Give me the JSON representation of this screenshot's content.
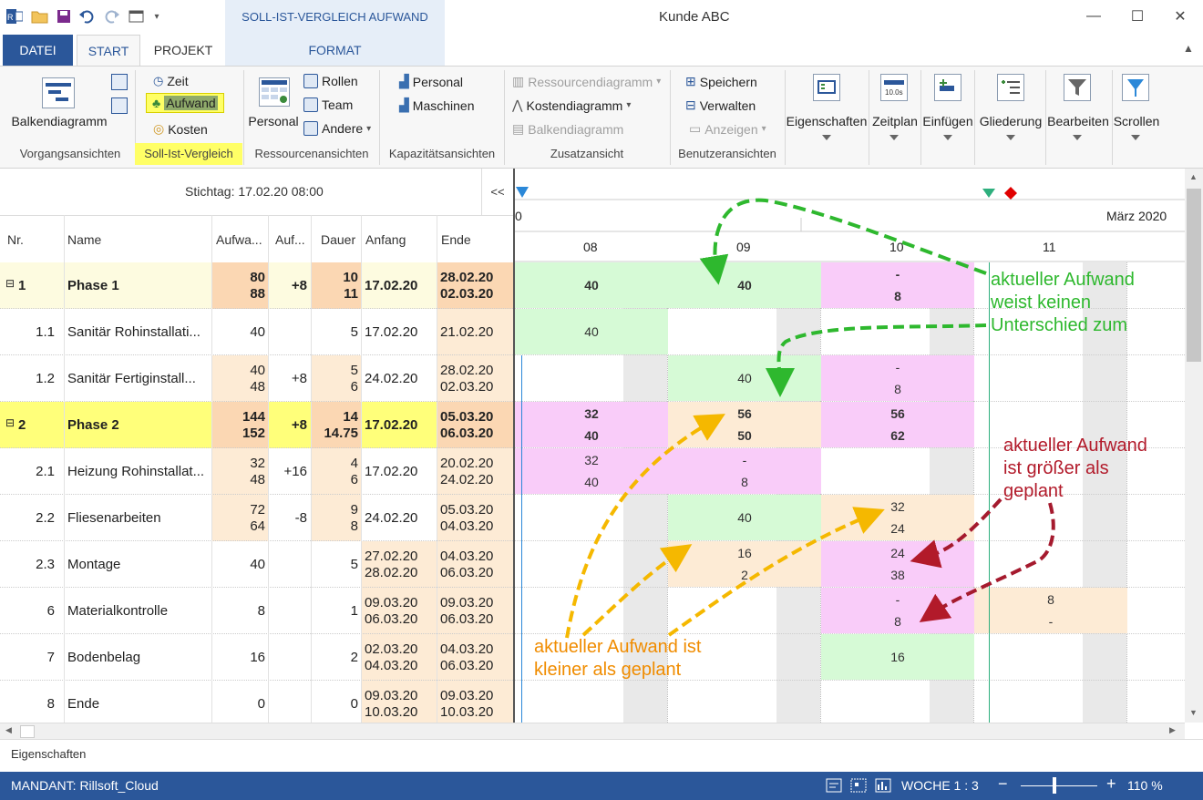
{
  "window": {
    "title": "Kunde ABC",
    "context_tab_title": "SOLL-IST-VERGLEICH AUFWAND",
    "controls": {
      "minimize": "—",
      "maximize": "☐",
      "close": "✕"
    }
  },
  "quick_access": {
    "app_icon": "rillsoft-app-icon",
    "open": "folder-open-icon",
    "save": "save-icon",
    "undo": "undo-icon",
    "redo": "redo-icon",
    "view": "window-icon"
  },
  "tabs": [
    {
      "label": "DATEI",
      "active": false
    },
    {
      "label": "START",
      "active": true
    },
    {
      "label": "PROJEKT",
      "active": false
    },
    {
      "label": "FORMAT",
      "active": false
    }
  ],
  "ribbon": {
    "groups": {
      "vorgang": {
        "label": "Vorgangsansichten",
        "big": "Balkendiagramm"
      },
      "soll": {
        "label": "Soll-Ist-Vergleich",
        "items": [
          "Zeit",
          "Aufwand",
          "Kosten"
        ]
      },
      "ressourcen": {
        "label": "Ressourcenansichten",
        "big": "Personal",
        "items": [
          "Rollen",
          "Team",
          "Andere"
        ]
      },
      "kapazitaet": {
        "label": "Kapazitätsansichten",
        "items": [
          "Personal",
          "Maschinen"
        ]
      },
      "zusatz": {
        "label": "Zusatzansicht",
        "items": [
          "Ressourcendiagramm",
          "Kostendiagramm",
          "Balkendiagramm"
        ]
      },
      "benutzer": {
        "label": "Benutzeransichten",
        "items": [
          "Speichern",
          "Verwalten",
          "Anzeigen"
        ]
      },
      "big_buttons": [
        "Eigenschaften",
        "Zeitplan",
        "Einfügen",
        "Gliederung",
        "Bearbeiten",
        "Scrollen"
      ]
    }
  },
  "table": {
    "stichtag": "Stichtag: 17.02.20 08:00",
    "collapse_label": "<<",
    "columns": [
      "Nr.",
      "Name",
      "Aufwa...",
      "Auf...",
      "Dauer",
      "Anfang",
      "Ende"
    ],
    "rows": [
      {
        "nr": "1",
        "name": "Phase 1",
        "aufwand": [
          "80",
          "88"
        ],
        "diff": "+8",
        "dauer": [
          "10",
          "11"
        ],
        "anfang": [
          "17.02.20"
        ],
        "ende": [
          "28.02.20",
          "02.03.20"
        ],
        "summary": true,
        "collapse": "⊟"
      },
      {
        "nr": "1.1",
        "name": "Sanitär Rohinstallati...",
        "aufwand": [
          "40"
        ],
        "diff": "",
        "dauer": [
          "5"
        ],
        "anfang": [
          "17.02.20"
        ],
        "ende": [
          "21.02.20"
        ]
      },
      {
        "nr": "1.2",
        "name": "Sanitär Fertiginstall...",
        "aufwand": [
          "40",
          "48"
        ],
        "diff": "+8",
        "dauer": [
          "5",
          "6"
        ],
        "anfang": [
          "24.02.20"
        ],
        "ende": [
          "28.02.20",
          "02.03.20"
        ]
      },
      {
        "nr": "2",
        "name": "Phase 2",
        "aufwand": [
          "144",
          "152"
        ],
        "diff": "+8",
        "dauer": [
          "14",
          "14.75"
        ],
        "anfang": [
          "17.02.20"
        ],
        "ende": [
          "05.03.20",
          "06.03.20"
        ],
        "summary": true,
        "collapse": "⊟"
      },
      {
        "nr": "2.1",
        "name": "Heizung Rohinstallat...",
        "aufwand": [
          "32",
          "48"
        ],
        "diff": "+16",
        "dauer": [
          "4",
          "6"
        ],
        "anfang": [
          "17.02.20"
        ],
        "ende": [
          "20.02.20",
          "24.02.20"
        ]
      },
      {
        "nr": "2.2",
        "name": "Fliesenarbeiten",
        "aufwand": [
          "72",
          "64"
        ],
        "diff": "-8",
        "dauer": [
          "9",
          "8"
        ],
        "anfang": [
          "24.02.20"
        ],
        "ende": [
          "05.03.20",
          "04.03.20"
        ]
      },
      {
        "nr": "2.3",
        "name": "Montage",
        "aufwand": [
          "40"
        ],
        "diff": "",
        "dauer": [
          "5"
        ],
        "anfang": [
          "27.02.20",
          "28.02.20"
        ],
        "ende": [
          "04.03.20",
          "06.03.20"
        ]
      },
      {
        "nr": "6",
        "name": "Materialkontrolle",
        "aufwand": [
          "8"
        ],
        "diff": "",
        "dauer": [
          "1"
        ],
        "anfang": [
          "09.03.20",
          "06.03.20"
        ],
        "ende": [
          "09.03.20",
          "06.03.20"
        ]
      },
      {
        "nr": "7",
        "name": "Bodenbelag",
        "aufwand": [
          "16"
        ],
        "diff": "",
        "dauer": [
          "2"
        ],
        "anfang": [
          "02.03.20",
          "04.03.20"
        ],
        "ende": [
          "04.03.20",
          "06.03.20"
        ]
      },
      {
        "nr": "8",
        "name": "Ende",
        "aufwand": [
          "0"
        ],
        "diff": "",
        "dauer": [
          "0"
        ],
        "anfang": [
          "09.03.20",
          "10.03.20"
        ],
        "ende": [
          "09.03.20",
          "10.03.20"
        ]
      }
    ]
  },
  "gantt": {
    "top_label_left": "0",
    "month": "März 2020",
    "weeks": [
      "08",
      "09",
      "10",
      "11"
    ],
    "bars": [
      [
        "40"
      ],
      [
        "40"
      ],
      [
        "-",
        "8"
      ],
      [
        "40"
      ],
      [
        "40"
      ],
      [
        "-",
        "8"
      ],
      [
        "32",
        "40"
      ],
      [
        "56",
        "50"
      ],
      [
        "56",
        "62"
      ],
      [
        "32",
        "40"
      ],
      [
        "-",
        "8"
      ],
      [
        "40"
      ],
      [
        "32",
        "24"
      ],
      [
        "16",
        "2"
      ],
      [
        "24",
        "38"
      ],
      [
        "-",
        "8"
      ],
      [
        "8",
        "-"
      ],
      [
        "16"
      ]
    ]
  },
  "annotations": {
    "green": [
      "aktueller Aufwand",
      "weist keinen",
      "Unterschied zum"
    ],
    "red": [
      "aktueller Aufwand",
      "ist größer als",
      "geplant"
    ],
    "orange": [
      "aktueller Aufwand ist",
      "kleiner als geplant"
    ]
  },
  "colors": {
    "ribbon_blue": "#2b579a",
    "highlight_yellow": "#ffff66",
    "green_cell": "#d6fad6",
    "pink_cell": "#f9ccf9",
    "beige_cell": "#fdebd5",
    "orange_cell": "#fbd7b3",
    "annotation_green": "#2eb82e",
    "annotation_red": "#b21a2a",
    "annotation_orange": "#f08c00"
  },
  "properties_bar": {
    "label": "Eigenschaften"
  },
  "status": {
    "mandant": "MANDANT: Rillsoft_Cloud",
    "woche": "WOCHE 1 : 3",
    "zoom": "110 %",
    "minus": "−",
    "plus": "+"
  }
}
